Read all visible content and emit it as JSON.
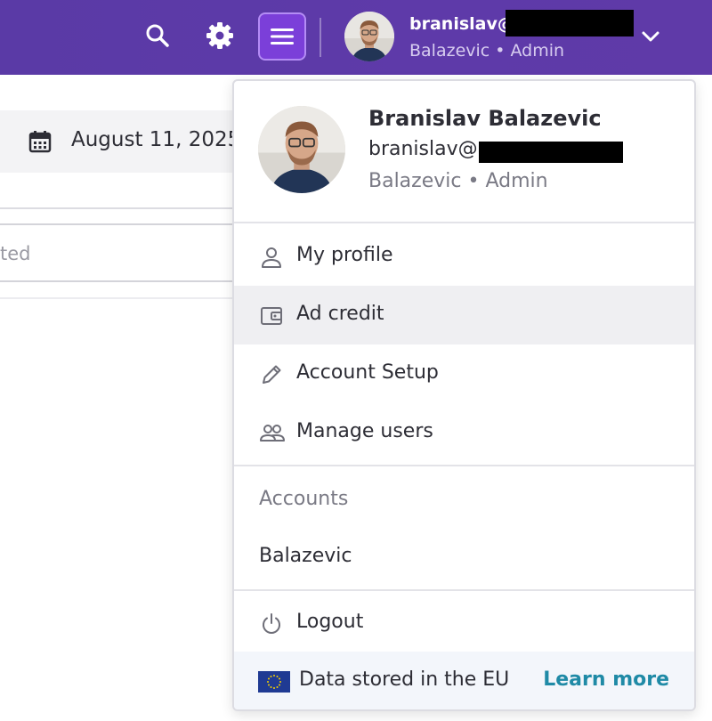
{
  "topbar": {
    "icons": [
      "search-icon",
      "gear-icon",
      "menu-icon",
      "chevron-down-icon"
    ],
    "user_email_visible": "branislav@",
    "user_subtitle": "Balazevic • Admin",
    "accent_color": "#5e3aa9",
    "menu_button_color": "#7b3fd9"
  },
  "background": {
    "date_text": "August 11, 2025 -",
    "field_text": "ted"
  },
  "dropdown": {
    "user": {
      "name": "Branislav Balazevic",
      "email_visible": "branislav@",
      "role": "Balazevic • Admin"
    },
    "menu_items": [
      {
        "label": "My profile",
        "icon": "user-icon"
      },
      {
        "label": "Ad credit",
        "icon": "wallet-icon"
      },
      {
        "label": "Account Setup",
        "icon": "pencil-icon"
      },
      {
        "label": "Manage users",
        "icon": "users-icon"
      }
    ],
    "accounts_label": "Accounts",
    "accounts": [
      "Balazevic"
    ],
    "logout_label": "Logout",
    "footer": {
      "text": "Data stored in the EU",
      "link": "Learn more",
      "link_color": "#1f8aa6"
    }
  }
}
